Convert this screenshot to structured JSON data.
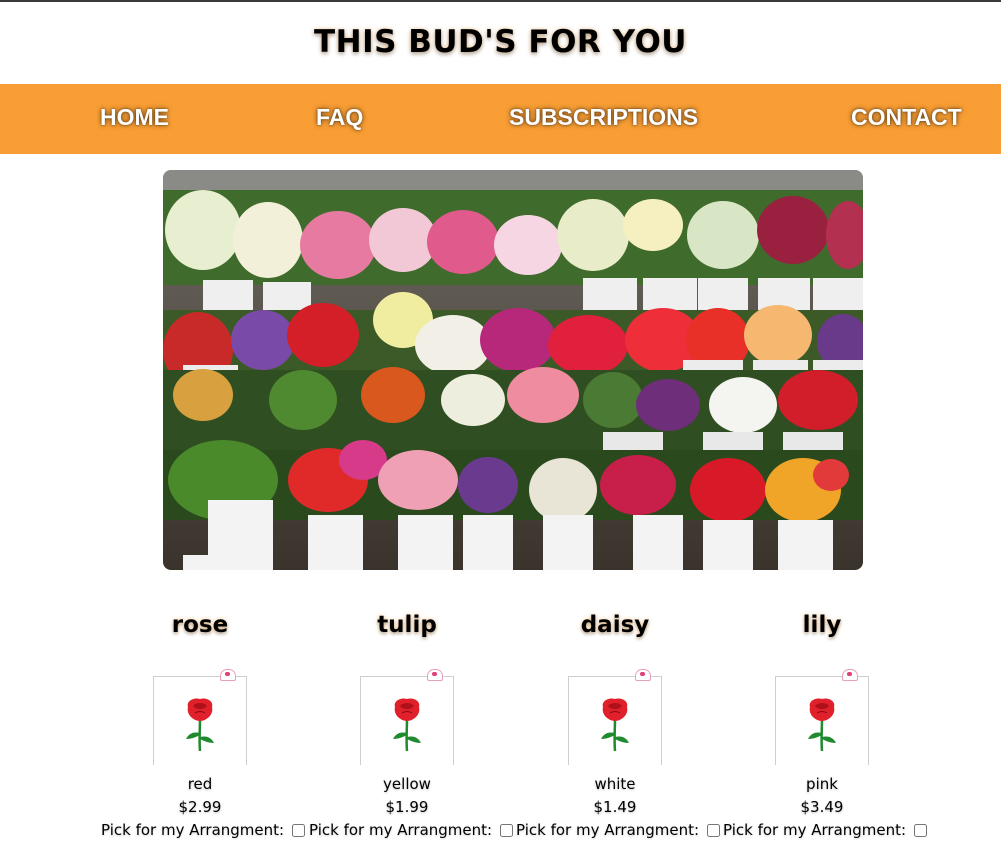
{
  "header": {
    "title": "THIS BUD'S FOR YOU"
  },
  "nav": {
    "items": [
      {
        "label": "HOME"
      },
      {
        "label": "FAQ"
      },
      {
        "label": "SUBSCRIPTIONS"
      },
      {
        "label": "CONTACT"
      }
    ]
  },
  "hero": {
    "image": "flower-shop-display-photo"
  },
  "products": [
    {
      "name": "rose",
      "color": "red",
      "price": "$2.99",
      "pick_label": "Pick for my Arrangment:",
      "checked": false,
      "icon": "rose-icon"
    },
    {
      "name": "tulip",
      "color": "yellow",
      "price": "$1.99",
      "pick_label": "Pick for my Arrangment:",
      "checked": false,
      "icon": "rose-icon"
    },
    {
      "name": "daisy",
      "color": "white",
      "price": "$1.49",
      "pick_label": "Pick for my Arrangment:",
      "checked": false,
      "icon": "rose-icon"
    },
    {
      "name": "lily",
      "color": "pink",
      "price": "$3.49",
      "pick_label": "Pick for my Arrangment:",
      "checked": false,
      "icon": "rose-icon"
    }
  ],
  "colors": {
    "nav_background": "#f99e34",
    "nav_text": "#ffffff",
    "accent_red": "#e0202a",
    "stem_green": "#1f8a2e"
  }
}
